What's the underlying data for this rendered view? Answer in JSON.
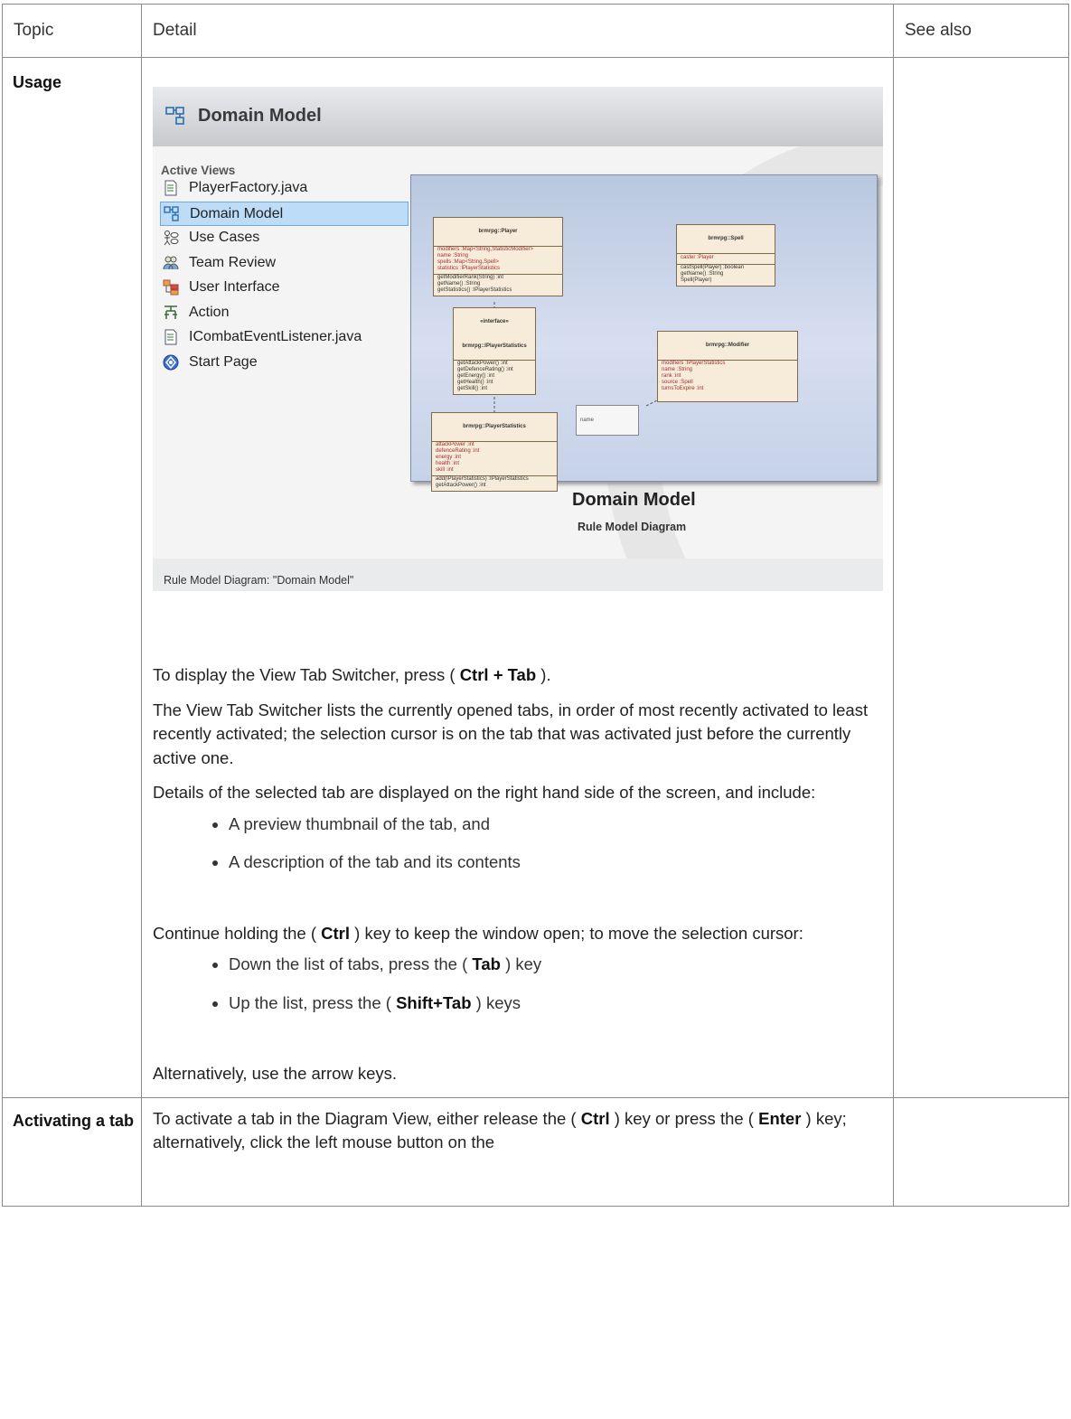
{
  "header": {
    "topic": "Topic",
    "detail": "Detail",
    "see_also": "See also"
  },
  "rows": [
    {
      "topic": "Usage",
      "screenshot": {
        "header_title": "Domain Model",
        "active_views_label": "Active Views",
        "views": [
          {
            "label": "PlayerFactory.java",
            "icon": "java-file-icon",
            "selected": false
          },
          {
            "label": "Domain Model",
            "icon": "diagram-icon",
            "selected": true
          },
          {
            "label": "Use Cases",
            "icon": "use-case-icon",
            "selected": false
          },
          {
            "label": "Team Review",
            "icon": "team-icon",
            "selected": false
          },
          {
            "label": "User Interface",
            "icon": "user-interface-icon",
            "selected": false
          },
          {
            "label": "Action",
            "icon": "action-icon",
            "selected": false
          },
          {
            "label": "ICombatEventListener.java",
            "icon": "java-file-icon",
            "selected": false
          },
          {
            "label": "Start Page",
            "icon": "start-page-icon",
            "selected": false
          }
        ],
        "preview_title": "Domain Model",
        "preview_subtitle": "Rule Model Diagram",
        "footer": "Rule Model Diagram: \"Domain Model\"",
        "classes": {
          "player": {
            "name": "brmrpg::Player",
            "attrs": [
              "modifiers :Map<String,StatisticModifier>",
              "name :String",
              "spells :Map<String,Spell>",
              "statistics :IPlayerStatistics"
            ],
            "ops": [
              "getModifierRank(String) :int",
              "getName() :String",
              "getStatistics() :IPlayerStatistics"
            ]
          },
          "spell": {
            "name": "brmrpg::Spell",
            "attrs": [
              "caster :Player"
            ],
            "ops": [
              "castSpell(Player) :boolean",
              "getName() :String",
              "Spell(Player)"
            ]
          },
          "iface": {
            "name": "«interface» brmrpg::IPlayerStatistics",
            "attrs": [],
            "ops": [
              "getAttackPower() :int",
              "getDefenceRating() :int",
              "getEnergy() :int",
              "getHealth() :int",
              "getSkill() :int"
            ]
          },
          "modifier": {
            "name": "brmrpg::Modifier",
            "attrs": [
              "modifiers :IPlayerStatistics",
              "name :String",
              "rank :int",
              "source :Spell",
              "turnsToExpire :int"
            ],
            "ops": []
          },
          "stats": {
            "name": "brmrpg::PlayerStatistics",
            "attrs": [
              "attackPower :int",
              "defenceRating :int",
              "energy :int",
              "health :int",
              "skill :int"
            ],
            "ops": [
              "add(IPlayerStatistics) :IPlayerStatistics",
              "getAttackPower() :int"
            ]
          },
          "note": "name"
        }
      },
      "paragraphs": {
        "p1_pre": "To display the View Tab Switcher, press ( ",
        "p1_key": "Ctrl + Tab",
        "p1_post": " ).",
        "p2": "The View Tab Switcher lists the currently opened tabs, in order of most recently activated to least recently activated; the selection cursor is on the tab that was activated just before the currently active one.",
        "p3": "Details of the selected tab are displayed on the right hand side of the screen, and include:",
        "bullets1": [
          "A preview thumbnail of the tab, and",
          "A description of the tab and its contents"
        ],
        "p4_pre": "Continue holding the ( ",
        "p4_key": "Ctrl",
        "p4_post": " ) key to keep the window open; to move the selection cursor:",
        "b2_1_pre": "Down the list of tabs, press the ( ",
        "b2_1_key": "Tab",
        "b2_1_post": " ) key",
        "b2_2_pre": "Up the list, press the ( ",
        "b2_2_key": "Shift+Tab",
        "b2_2_post": " ) keys",
        "p5": "Alternatively, use the arrow keys."
      }
    },
    {
      "topic": "Activating a tab",
      "text": {
        "pre1": "To activate a tab in the Diagram View, either release the ( ",
        "key1": "Ctrl",
        "mid1": " ) key or press the ( ",
        "key2": "Enter",
        "post": " ) key; alternatively, click the left mouse button on the"
      }
    }
  ]
}
